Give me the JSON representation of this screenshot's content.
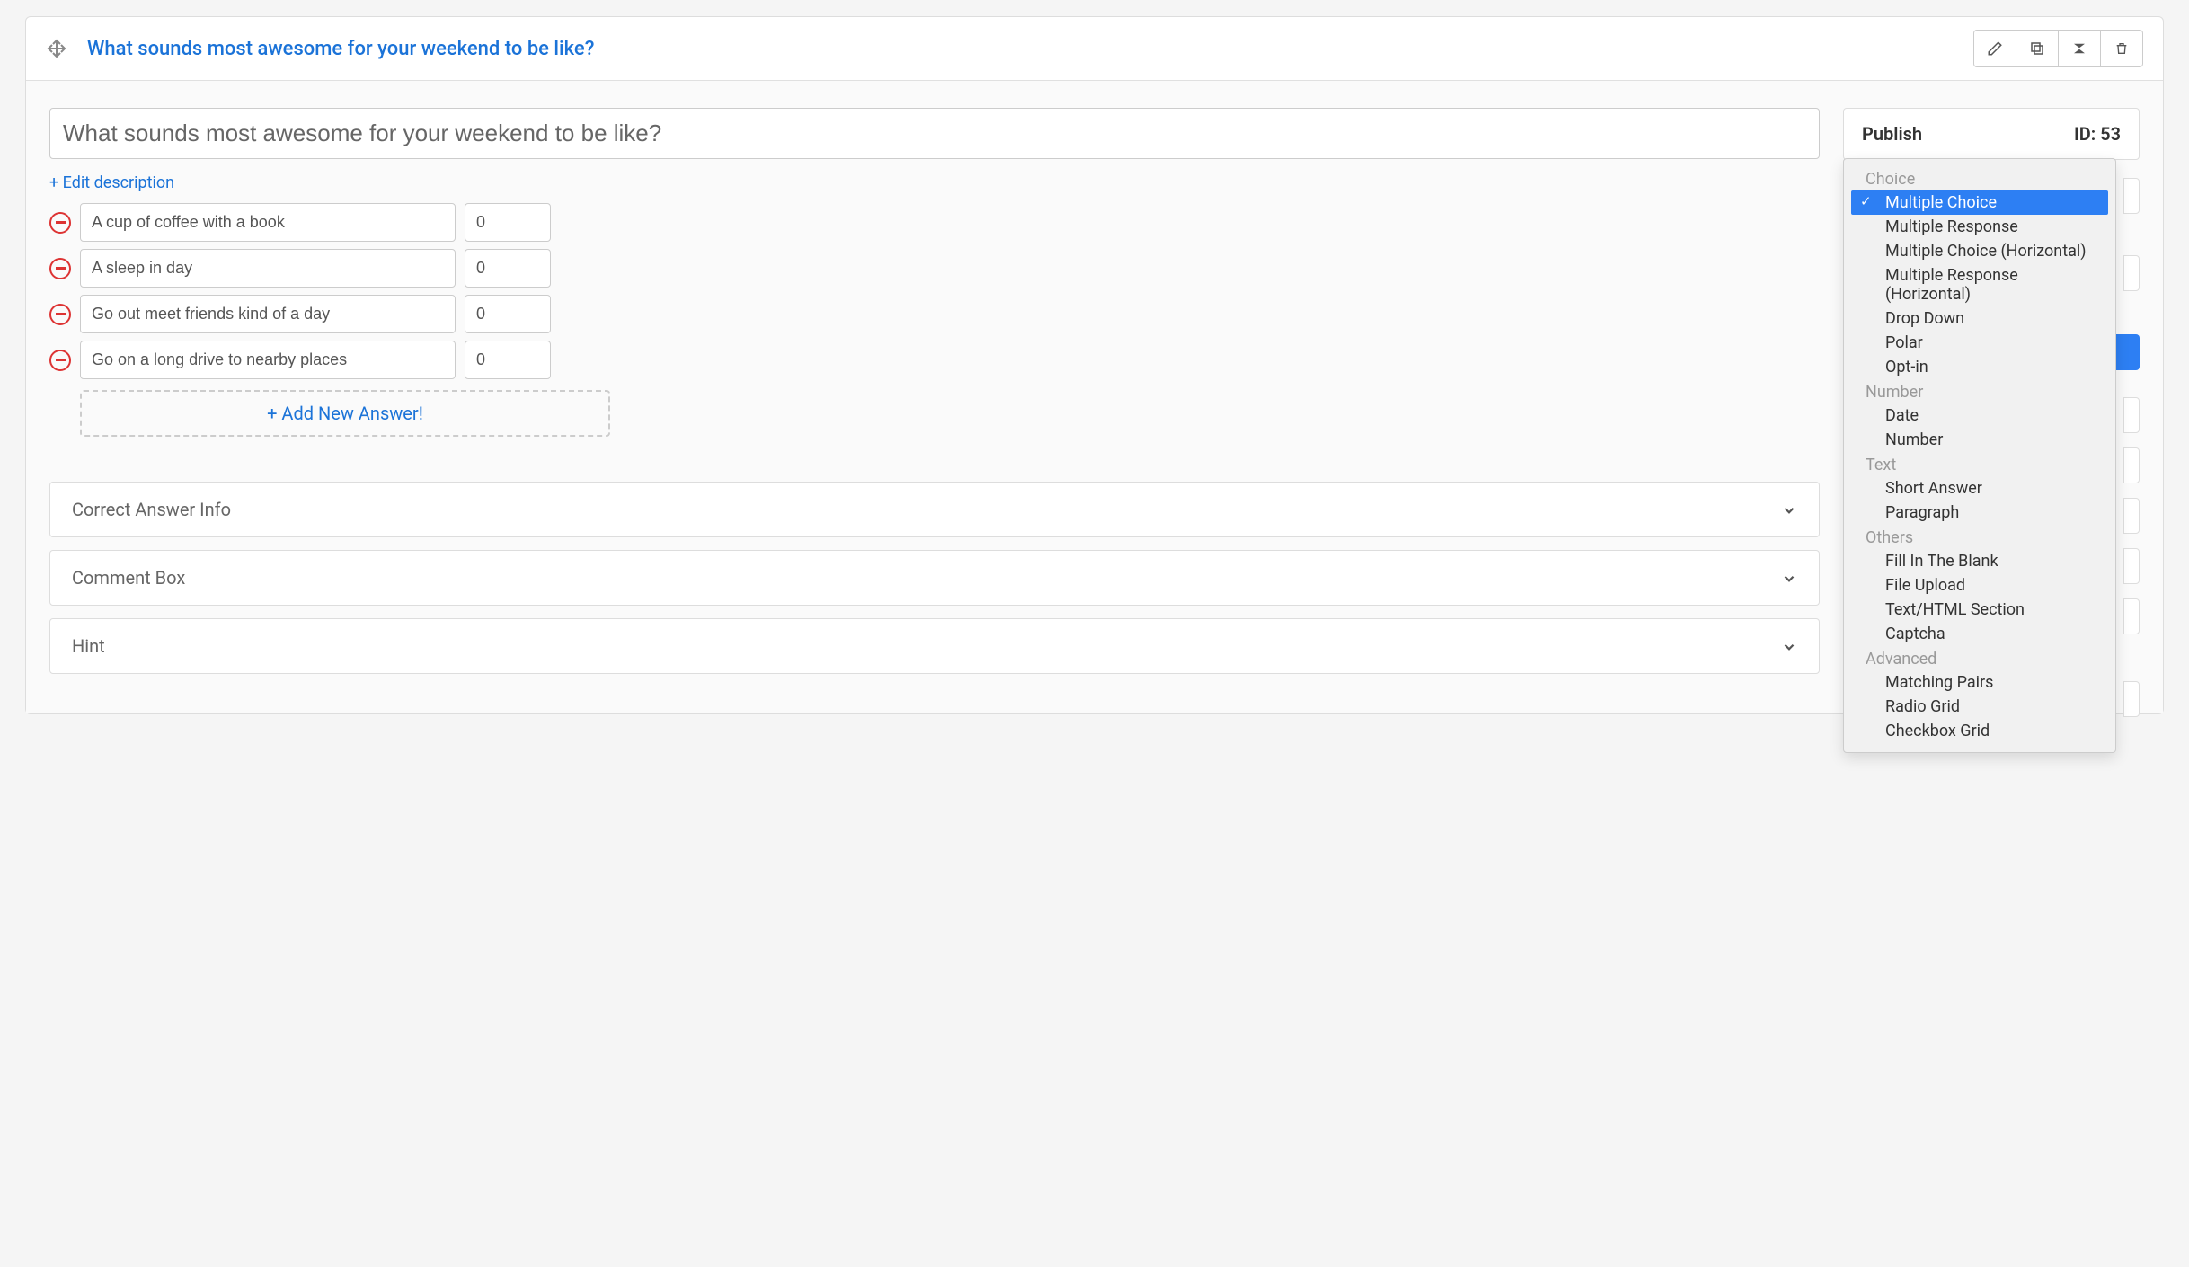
{
  "question": {
    "title_link": "What sounds most awesome for your weekend to be like?",
    "title_input": "What sounds most awesome for your weekend to be like?",
    "edit_desc": "+ Edit description",
    "answers": [
      {
        "text": "A cup of coffee with a book",
        "value": "0"
      },
      {
        "text": "A sleep in day",
        "value": "0"
      },
      {
        "text": "Go out meet friends kind of a day",
        "value": "0"
      },
      {
        "text": "Go on a long drive to nearby places",
        "value": "0"
      }
    ],
    "add_answer": "+ Add New Answer!"
  },
  "accordions": {
    "correct_answer": "Correct Answer Info",
    "comment_box": "Comment Box",
    "hint": "Hint"
  },
  "publish": {
    "label": "Publish",
    "id_label": "ID: 53"
  },
  "dropdown": {
    "groups": [
      {
        "label": "Choice",
        "items": [
          {
            "label": "Multiple Choice",
            "selected": true
          },
          {
            "label": "Multiple Response"
          },
          {
            "label": "Multiple Choice (Horizontal)"
          },
          {
            "label": "Multiple Response (Horizontal)"
          },
          {
            "label": "Drop Down"
          },
          {
            "label": "Polar"
          },
          {
            "label": "Opt-in"
          }
        ]
      },
      {
        "label": "Number",
        "items": [
          {
            "label": "Date"
          },
          {
            "label": "Number"
          }
        ]
      },
      {
        "label": "Text",
        "items": [
          {
            "label": "Short Answer"
          },
          {
            "label": "Paragraph"
          }
        ]
      },
      {
        "label": "Others",
        "items": [
          {
            "label": "Fill In The Blank"
          },
          {
            "label": "File Upload"
          },
          {
            "label": "Text/HTML Section"
          },
          {
            "label": "Captcha"
          }
        ]
      },
      {
        "label": "Advanced",
        "items": [
          {
            "label": "Matching Pairs"
          },
          {
            "label": "Radio Grid"
          },
          {
            "label": "Checkbox Grid"
          }
        ]
      }
    ]
  }
}
